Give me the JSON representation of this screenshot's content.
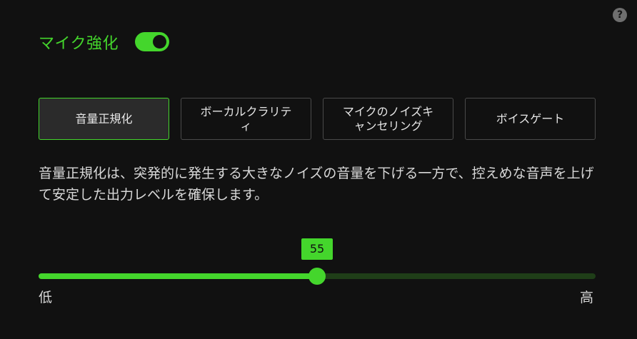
{
  "help": {
    "icon": "help-icon",
    "symbol": "?"
  },
  "header": {
    "title": "マイク強化",
    "toggle_on": true,
    "accent": "#44d62c"
  },
  "tabs": [
    {
      "label": "音量正規化",
      "active": true
    },
    {
      "label": "ボーカルクラリテ\nィ",
      "active": false
    },
    {
      "label": "マイクのノイズキ\nャンセリング",
      "active": false
    },
    {
      "label": "ボイスゲート",
      "active": false
    }
  ],
  "description": "音量正規化は、突発的に発生する大きなノイズの音量を下げる一方で、控えめな音声を上げて安定した出力レベルを確保します。",
  "slider": {
    "value": 55,
    "value_label": "55",
    "fraction": 0.5,
    "low_label": "低",
    "high_label": "高"
  }
}
